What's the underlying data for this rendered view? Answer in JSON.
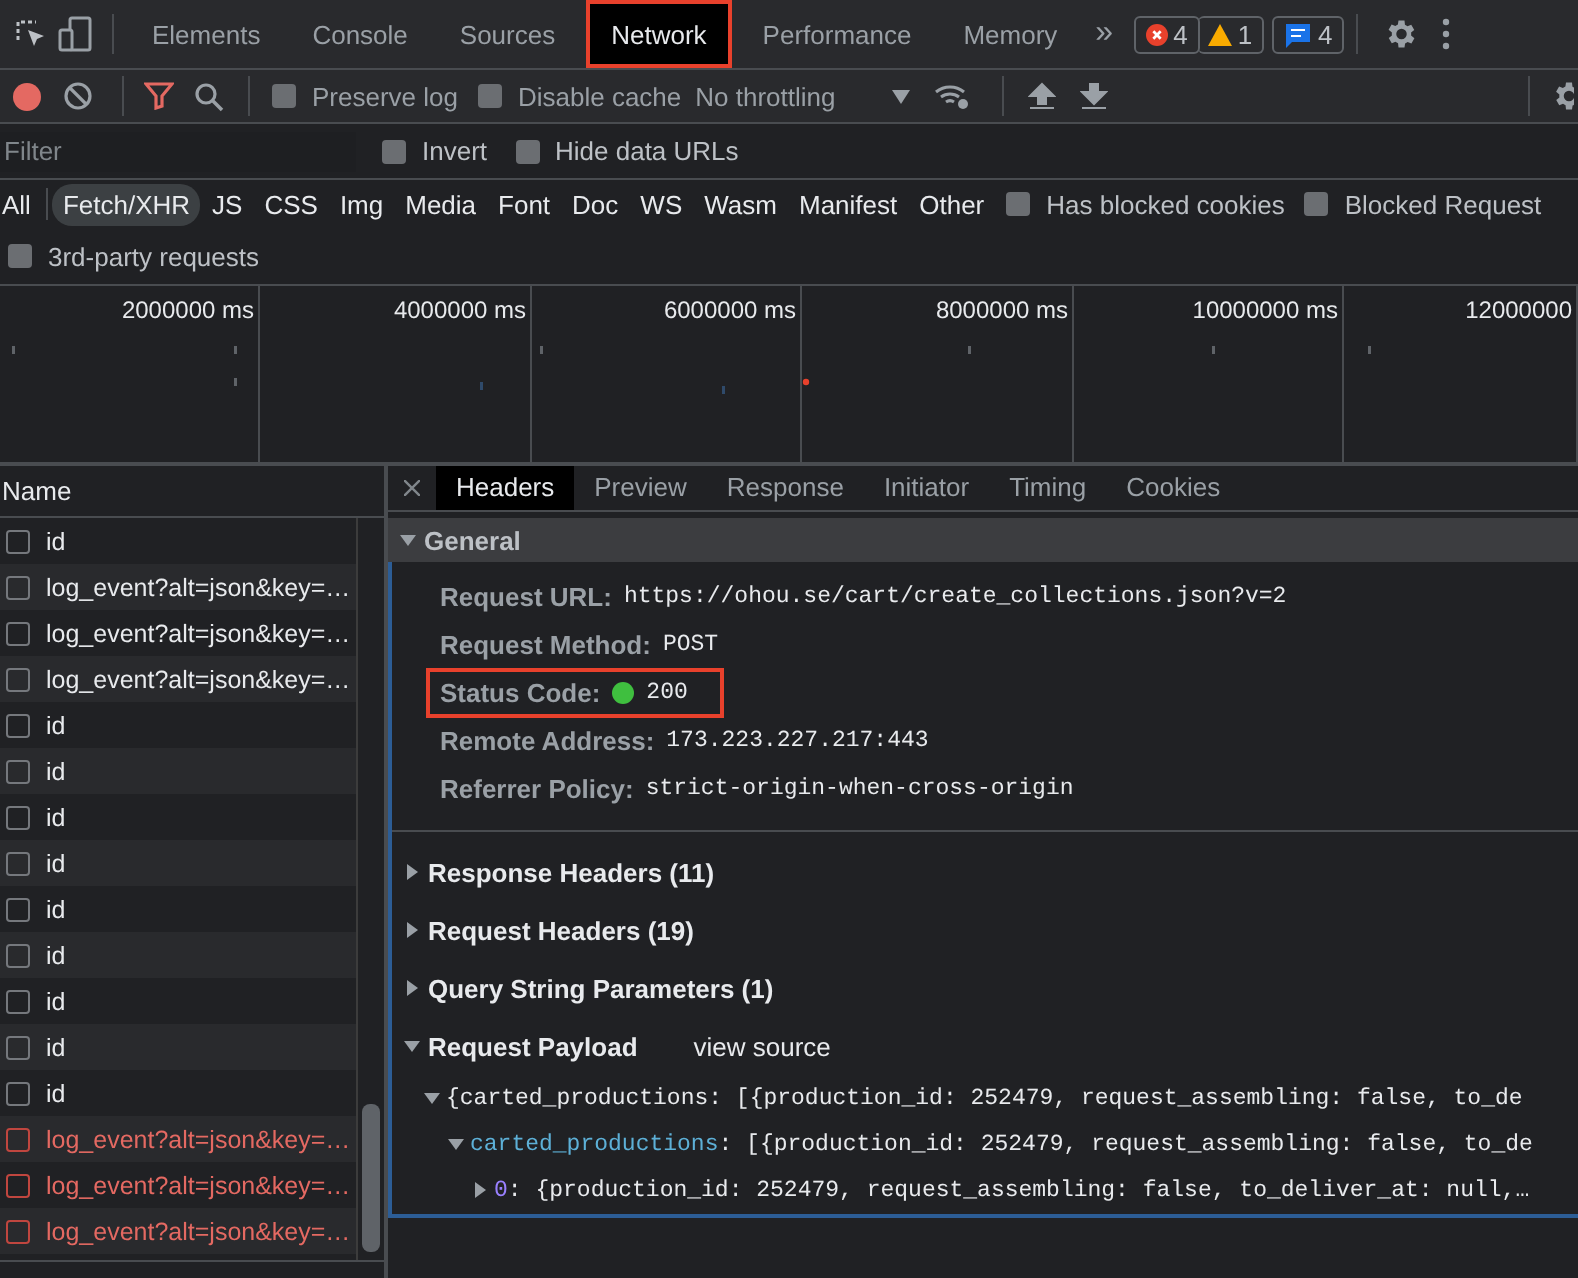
{
  "panel_tabs": [
    {
      "label": "Elements",
      "selected": false,
      "highlighted": false
    },
    {
      "label": "Console",
      "selected": false,
      "highlighted": false
    },
    {
      "label": "Sources",
      "selected": false,
      "highlighted": false
    },
    {
      "label": "Network",
      "selected": true,
      "highlighted": true
    },
    {
      "label": "Performance",
      "selected": false,
      "highlighted": false
    },
    {
      "label": "Memory",
      "selected": false,
      "highlighted": false
    }
  ],
  "overflow": "»",
  "counters": [
    {
      "kind": "error",
      "count": "4"
    },
    {
      "kind": "warning",
      "count": "1"
    },
    {
      "kind": "message",
      "count": "4"
    }
  ],
  "toolbar": {
    "recording": true,
    "filter_active": true,
    "options": [
      {
        "label": "Preserve log",
        "checked": false
      },
      {
        "label": "Disable cache",
        "checked": false
      }
    ],
    "throttling": "No throttling"
  },
  "filter": {
    "placeholder": "Filter",
    "options": [
      {
        "label": "Invert",
        "checked": false
      },
      {
        "label": "Hide data URLs",
        "checked": false
      }
    ]
  },
  "types": [
    {
      "label": "All",
      "selected": false
    },
    {
      "label": "Fetch/XHR",
      "selected": true
    },
    {
      "label": "JS",
      "selected": false
    },
    {
      "label": "CSS",
      "selected": false
    },
    {
      "label": "Img",
      "selected": false
    },
    {
      "label": "Media",
      "selected": false
    },
    {
      "label": "Font",
      "selected": false
    },
    {
      "label": "Doc",
      "selected": false
    },
    {
      "label": "WS",
      "selected": false
    },
    {
      "label": "Wasm",
      "selected": false
    },
    {
      "label": "Manifest",
      "selected": false
    },
    {
      "label": "Other",
      "selected": false
    }
  ],
  "type_options": [
    {
      "label": "Has blocked cookies",
      "checked": false
    },
    {
      "label": "Blocked Request",
      "checked": false
    }
  ],
  "third_party": {
    "label": "3rd-party requests",
    "checked": false
  },
  "timeline": {
    "ticks": [
      "2000000 ms",
      "4000000 ms",
      "6000000 ms",
      "8000000 ms",
      "10000000 ms",
      "12000000"
    ]
  },
  "requests": {
    "column": "Name",
    "rows": [
      {
        "name": "id",
        "failed": false
      },
      {
        "name": "log_event?alt=json&key=…",
        "failed": false
      },
      {
        "name": "log_event?alt=json&key=…",
        "failed": false
      },
      {
        "name": "log_event?alt=json&key=…",
        "failed": false
      },
      {
        "name": "id",
        "failed": false
      },
      {
        "name": "id",
        "failed": false
      },
      {
        "name": "id",
        "failed": false
      },
      {
        "name": "id",
        "failed": false
      },
      {
        "name": "id",
        "failed": false
      },
      {
        "name": "id",
        "failed": false
      },
      {
        "name": "id",
        "failed": false
      },
      {
        "name": "id",
        "failed": false
      },
      {
        "name": "id",
        "failed": false
      },
      {
        "name": "log_event?alt=json&key=…",
        "failed": true
      },
      {
        "name": "log_event?alt=json&key=…",
        "failed": true
      },
      {
        "name": "log_event?alt=json&key=…",
        "failed": true
      }
    ]
  },
  "detail_tabs": [
    {
      "label": "Headers",
      "selected": true
    },
    {
      "label": "Preview",
      "selected": false
    },
    {
      "label": "Response",
      "selected": false
    },
    {
      "label": "Initiator",
      "selected": false
    },
    {
      "label": "Timing",
      "selected": false
    },
    {
      "label": "Cookies",
      "selected": false
    }
  ],
  "general": {
    "title": "General",
    "expanded": true,
    "fields": [
      {
        "label": "Request URL:",
        "value": "https://ohou.se/cart/create_collections.json?v=2",
        "kind": "text",
        "highlighted": false
      },
      {
        "label": "Request Method:",
        "value": "POST",
        "kind": "text",
        "highlighted": false
      },
      {
        "label": "Status Code:",
        "value": "200",
        "kind": "status",
        "color": "#3fbf3f",
        "highlighted": true
      },
      {
        "label": "Remote Address:",
        "value": "173.223.227.217:443",
        "kind": "text",
        "highlighted": false
      },
      {
        "label": "Referrer Policy:",
        "value": "strict-origin-when-cross-origin",
        "kind": "text",
        "highlighted": false
      }
    ]
  },
  "sections": [
    {
      "title": "Response Headers (11)",
      "expanded": false
    },
    {
      "title": "Request Headers (19)",
      "expanded": false
    },
    {
      "title": "Query String Parameters (1)",
      "expanded": false
    },
    {
      "title": "Request Payload",
      "expanded": true,
      "link": "view source"
    }
  ],
  "payload": [
    {
      "text": "{carted_productions: [{production_id: 252479, request_assembling: false, to_de",
      "expanded": true,
      "children": [
        {
          "key": "carted_productions",
          "kind": "property",
          "text": ": [{production_id: 252479, request_assembling: false, to_de",
          "expanded": true,
          "children": [
            {
              "key": "0",
              "kind": "index",
              "text": ": {production_id: 252479, request_assembling: false, to_deliver_at: null,…",
              "expanded": false
            }
          ]
        }
      ]
    }
  ]
}
